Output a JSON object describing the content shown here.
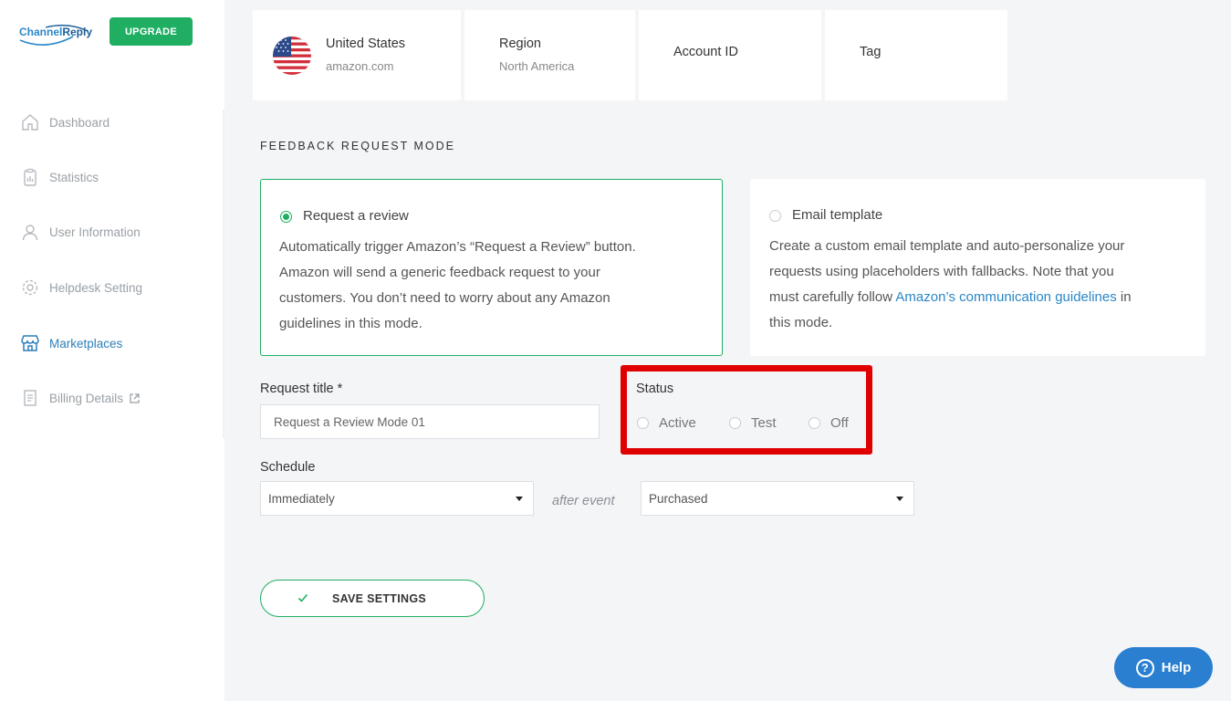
{
  "brand": {
    "name_part1": "Channel",
    "name_part2": "Reply",
    "upgrade_label": "UPGRADE"
  },
  "sidebar": {
    "items": [
      {
        "label": "Dashboard",
        "icon": "home-icon",
        "active": false
      },
      {
        "label": "Statistics",
        "icon": "clipboard-chart-icon",
        "active": false
      },
      {
        "label": "User Information",
        "icon": "user-icon",
        "active": false
      },
      {
        "label": "Helpdesk Setting",
        "icon": "gear-icon",
        "active": false
      },
      {
        "label": "Marketplaces",
        "icon": "store-icon",
        "active": true
      },
      {
        "label": "Billing Details",
        "icon": "receipt-icon",
        "active": false,
        "external": true
      }
    ]
  },
  "marketplace": {
    "country": "United States",
    "domain": "amazon.com",
    "region_label": "Region",
    "region_value": "North America",
    "account_label": "Account ID",
    "tag_label": "Tag"
  },
  "feedback": {
    "section_title": "FEEDBACK REQUEST MODE",
    "modes": [
      {
        "label": "Request a review",
        "selected": true,
        "desc_lines": [
          "Automatically trigger Amazon’s “Request a Review” button.",
          "Amazon will send a generic feedback request to your",
          "customers. You don’t need to worry about any Amazon",
          "guidelines in this mode."
        ]
      },
      {
        "label": "Email template",
        "selected": false,
        "desc_line1": "Create a custom email template and auto-personalize your",
        "desc_line2": "requests using placeholders with fallbacks. Note that you",
        "desc_line3_pre": "must carefully follow ",
        "desc_link": "Amazon’s communication guidelines",
        "desc_line3_post": " in",
        "desc_line4": "this mode."
      }
    ]
  },
  "form": {
    "request_title_label": "Request title *",
    "request_title_value": "Request a Review Mode 01",
    "status_label": "Status",
    "status_options": [
      "Active",
      "Test",
      "Off"
    ],
    "schedule_label": "Schedule",
    "schedule_value": "Immediately",
    "after_event_text": "after event",
    "event_value": "Purchased",
    "save_label": "SAVE SETTINGS"
  },
  "help": {
    "label": "Help"
  },
  "colors": {
    "accent_green": "#1fae62",
    "link_blue": "#2a86c6",
    "highlight_red": "#e00000",
    "help_blue": "#2a7fd1"
  }
}
